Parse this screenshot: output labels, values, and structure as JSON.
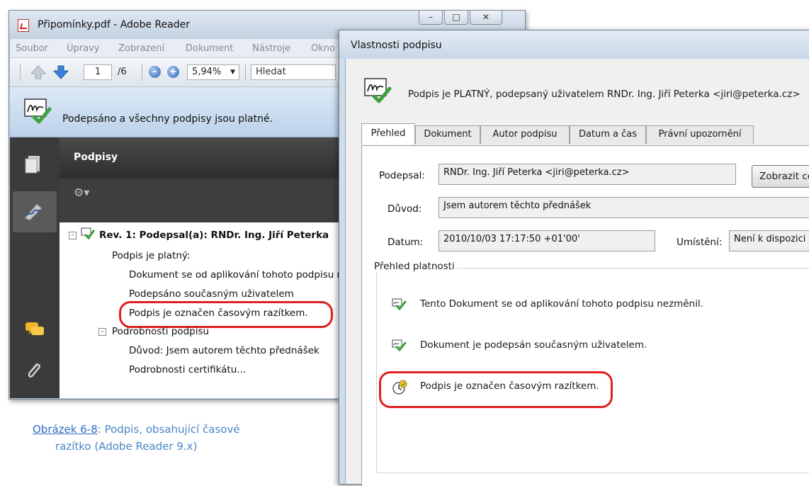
{
  "reader": {
    "title": "Připomínky.pdf - Adobe Reader",
    "window_buttons": [
      "–",
      "□",
      "✕"
    ],
    "menu": [
      "Soubor",
      "Úpravy",
      "Zobrazení",
      "Dokument",
      "Nástroje",
      "Okno"
    ],
    "toolbar": {
      "page_current": "1",
      "page_total": "/6",
      "zoom": "5,94%",
      "search": "Hledat"
    },
    "banner_message": "Podepsáno a všechny podpisy jsou platné.",
    "panel_title": "Podpisy",
    "tree": {
      "revision": "Rev. 1: Podepsal(a): RNDr. Ing. Jiří Peterka",
      "valid": "Podpis je platný:",
      "item1": "Dokument se od aplikování tohoto podpisu nezměnil",
      "item2": "Podepsáno současným uživatelem",
      "item3": "Podpis je označen časovým razítkem.",
      "details": "Podrobnosti podpisu",
      "reason": "Důvod: Jsem autorem těchto přednášek",
      "cert": "Podrobnosti certifikátu..."
    }
  },
  "caption": {
    "link": "Obrázek 6-8",
    "rest": ": Podpis, obsahující časové",
    "line2": "razítko (Adobe Reader 9.x)"
  },
  "dialog": {
    "title": "Vlastnosti podpisu",
    "status_header": "Podpis je PLATNÝ, podepsaný uživatelem RNDr. Ing. Jiří Peterka <jiri@peterka.cz>",
    "tabs": [
      "Přehled",
      "Dokument",
      "Autor podpisu",
      "Datum a čas",
      "Právní upozornění"
    ],
    "signed_by_label": "Podepsal:",
    "signed_by_value": "RNDr. Ing. Jiří Peterka <jiri@peterka.cz>",
    "show_button": "Zobrazit certifikát...",
    "reason_label": "Důvod:",
    "reason_value": "Jsem autorem těchto přednášek",
    "date_label": "Datum:",
    "date_value": "2010/10/03 17:17:50 +01'00'",
    "location_label": "Umístění:",
    "location_value": "Není k dispozici",
    "validity_group": "Přehled platnosti",
    "validity": [
      "Tento Dokument se od aplikování tohoto podpisu nezměnil.",
      "Dokument je podepsán současným uživatelem.",
      "Podpis je označen časovým razítkem."
    ]
  },
  "colors": {
    "highlight_oval": "#e02020",
    "banner": "#c9dcef",
    "caption": "#4a86c5"
  }
}
